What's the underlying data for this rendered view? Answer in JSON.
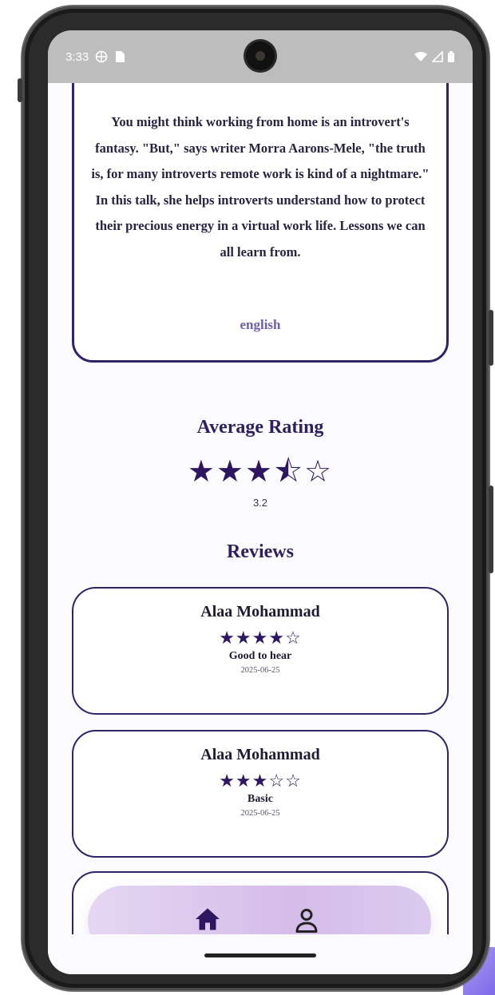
{
  "status_bar": {
    "time": "3:33"
  },
  "talk": {
    "description": "You might think working from home is an introvert's fantasy. \"But,\" says writer Morra Aarons-Mele, \"the truth is, for many introverts remote work is kind of a nightmare.\" In this talk, she helps introverts understand how to protect their precious energy in a virtual work life. Lessons we can all learn from.",
    "language": "english"
  },
  "rating": {
    "title": "Average Rating",
    "stars": "★★★⯪☆",
    "value": "3.2"
  },
  "reviews": {
    "title": "Reviews",
    "items": [
      {
        "name": "Alaa Mohammad",
        "stars": "★★★★☆",
        "comment": "Good to hear",
        "date": "2025-06-25"
      },
      {
        "name": "Alaa Mohammad",
        "stars": "★★★☆☆",
        "comment": "Basic",
        "date": "2025-06-25"
      }
    ]
  },
  "nav": {
    "items": [
      {
        "icon": "home-icon",
        "active": true
      },
      {
        "icon": "profile-icon",
        "active": false
      }
    ]
  },
  "colors": {
    "accent": "#2e1760",
    "card_border": "#2e2466",
    "nav_background": "#d4bde9",
    "status_bar": "#bdbdbd"
  }
}
